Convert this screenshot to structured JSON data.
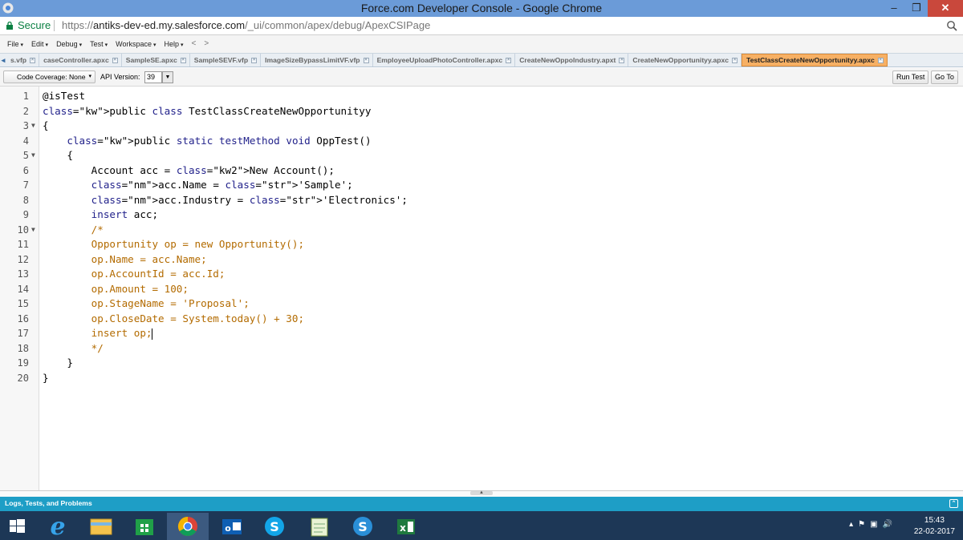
{
  "window": {
    "title": "Force.com Developer Console - Google Chrome",
    "min": "–",
    "max": "❐",
    "close": "✕"
  },
  "address": {
    "secure_label": "Secure",
    "url_scheme": "https://",
    "url_host": "antiks-dev-ed.my.salesforce.com",
    "url_path": "/_ui/common/apex/debug/ApexCSIPage"
  },
  "menu": {
    "items": [
      "File",
      "Edit",
      "Debug",
      "Test",
      "Workspace",
      "Help"
    ],
    "back": "<",
    "forward": ">"
  },
  "tabs": [
    {
      "label": "s.vfp"
    },
    {
      "label": "caseController.apxc"
    },
    {
      "label": "SampleSE.apxc"
    },
    {
      "label": "SampleSEVF.vfp"
    },
    {
      "label": "ImageSizeBypassLimitVF.vfp"
    },
    {
      "label": "EmployeeUploadPhotoController.apxc"
    },
    {
      "label": "CreateNewOppoIndustry.apxt"
    },
    {
      "label": "CreateNewOpportunityy.apxc"
    },
    {
      "label": "TestClassCreateNewOpportunityy.apxc",
      "active": true
    }
  ],
  "toolbar": {
    "coverage": "Code Coverage: None",
    "api_label": "API Version:",
    "api_value": "39",
    "run_test": "Run Test",
    "go_to": "Go To"
  },
  "code": {
    "lines": [
      {
        "n": "1",
        "text": "@isTest"
      },
      {
        "n": "2",
        "text": "public class TestClassCreateNewOpportunityy"
      },
      {
        "n": "3",
        "text": "{",
        "fold": true
      },
      {
        "n": "4",
        "text": "    public static testMethod void OppTest()"
      },
      {
        "n": "5",
        "text": "    {",
        "fold": true
      },
      {
        "n": "6",
        "text": "        Account acc = New Account();"
      },
      {
        "n": "7",
        "text": "        acc.Name = 'Sample';"
      },
      {
        "n": "8",
        "text": "        acc.Industry = 'Electronics';"
      },
      {
        "n": "9",
        "text": "        insert acc;"
      },
      {
        "n": "10",
        "text": "        /*",
        "fold": true
      },
      {
        "n": "11",
        "text": "        Opportunity op = new Opportunity();"
      },
      {
        "n": "12",
        "text": "        op.Name = acc.Name;"
      },
      {
        "n": "13",
        "text": "        op.AccountId = acc.Id;"
      },
      {
        "n": "14",
        "text": "        op.Amount = 100;"
      },
      {
        "n": "15",
        "text": "        op.StageName = 'Proposal';"
      },
      {
        "n": "16",
        "text": "        op.CloseDate = System.today() + 30;"
      },
      {
        "n": "17",
        "text": "        insert op;"
      },
      {
        "n": "18",
        "text": "        */"
      },
      {
        "n": "19",
        "text": "    }"
      },
      {
        "n": "20",
        "text": "}"
      }
    ]
  },
  "logs_panel": {
    "label": "Logs, Tests, and Problems"
  },
  "taskbar": {
    "apps": [
      "start",
      "internet-explorer",
      "file-explorer",
      "store",
      "chrome",
      "outlook",
      "skype",
      "notepad",
      "skype-business",
      "excel"
    ],
    "time": "15:43",
    "date": "22-02-2017"
  }
}
